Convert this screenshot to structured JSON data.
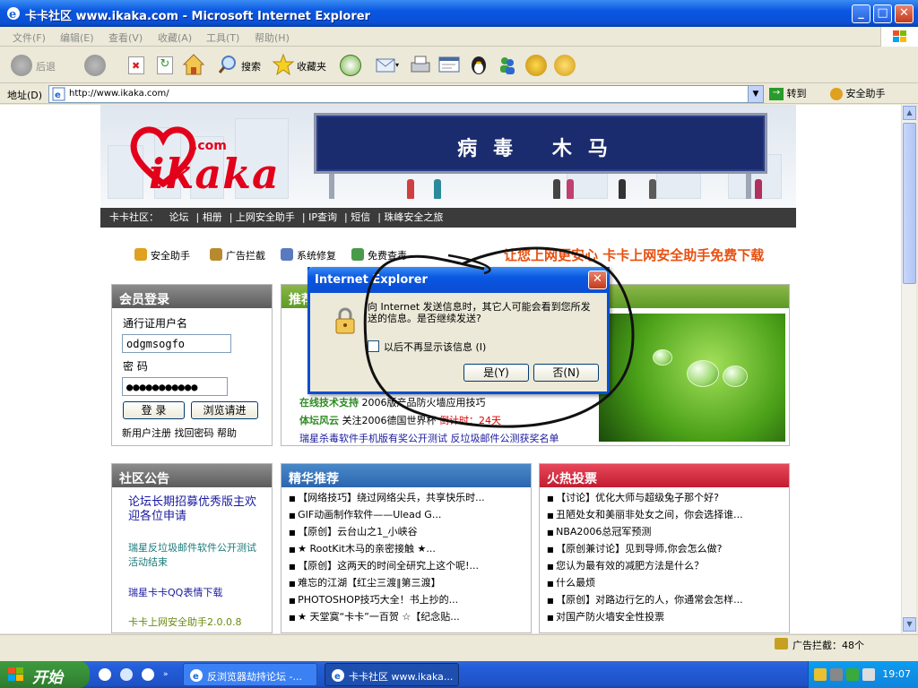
{
  "window": {
    "title": "卡卡社区 www.ikaka.com - Microsoft Internet Explorer"
  },
  "menu": [
    "文件(F)",
    "编辑(E)",
    "查看(V)",
    "收藏(A)",
    "工具(T)",
    "帮助(H)"
  ],
  "toolbar": {
    "back": "后退",
    "search": "搜索",
    "favorites": "收藏夹"
  },
  "address": {
    "label": "地址(D)",
    "url": "http://www.ikaka.com/",
    "go": "转到",
    "safety": "安全助手"
  },
  "banner": {
    "logo": "ikaka",
    "logo_com": ".com",
    "board": "病毒 木马"
  },
  "nav": {
    "label": "卡卡社区：",
    "items": [
      "论坛",
      "相册",
      "上网安全助手",
      "IP查询",
      "短信",
      "珠峰安全之旅"
    ]
  },
  "quick": {
    "items": [
      "安全助手",
      "广告拦截",
      "系统修复",
      "免费查毒"
    ],
    "slogan": "让您上网更安心 卡卡上网安全助手免费下载"
  },
  "login": {
    "title": "会员登录",
    "user_label": "通行证用户名",
    "username": "odgmsogfo",
    "pwd_label": "密  码",
    "password": "●●●●●●●●●●●",
    "login_btn": "登 录",
    "browse_btn": "浏览请进",
    "links": [
      "新用户注册",
      "找回密码",
      "帮助"
    ]
  },
  "recommend": {
    "title": "推荐",
    "items": [
      {
        "tag": "在线技术支持",
        "text": "2006版产品防火墙应用技巧"
      },
      {
        "tag": "体坛风云",
        "text": "关注2006德国世界杯",
        "hot": "倒计时：24天"
      }
    ],
    "bottom": "瑞星杀毒软件手机版有奖公开测试  反垃圾邮件公测获奖名单"
  },
  "notice": {
    "title": "社区公告",
    "items": [
      "论坛长期招募优秀版主欢迎各位申请",
      "瑞星反垃圾邮件软件公开测试活动结束",
      "瑞星卡卡QQ表情下载",
      "卡卡上网安全助手2.0.0.8"
    ]
  },
  "featured": {
    "title": "精华推荐",
    "items": [
      "【网络技巧】绕过网络尖兵，共享快乐时...",
      "GIF动画制作软件——Ulead G...",
      "【原创】云台山之1_小峡谷",
      "★ RootKit木马的亲密接触 ★...",
      "【原创】这两天的时间全研究上这个呢!...",
      "难忘的江湖【红尘三渡‖第三渡】",
      "PHOTOSHOP技巧大全！书上抄的...",
      "★  天堂寞“卡卡”一百贺  ☆【纪念贴..."
    ]
  },
  "hot": {
    "title": "火热投票",
    "items": [
      "【讨论】优化大师与超级兔子那个好?",
      "丑陋处女和美丽非处女之间，你会选择谁...",
      "NBA2006总冠军预测",
      "【原创兼讨论】见到导师,你会怎么做?",
      "您认为最有效的减肥方法是什么？",
      "什么最烦",
      "【原创】对路边行乞的人，你通常会怎样...",
      "对国产防火墙安全性投票"
    ]
  },
  "dialog": {
    "title": "Internet Explorer",
    "message": "向 Internet 发送信息时，其它人可能会看到您所发送的信息。是否继续发送?",
    "checkbox": "以后不再显示该信息 (I)",
    "yes": "是(Y)",
    "no": "否(N)"
  },
  "status": {
    "adblock": "广告拦截：48个"
  },
  "taskbar": {
    "start": "开始",
    "tasks": [
      "反浏览器劫持论坛 -...",
      "卡卡社区 www.ikaka..."
    ],
    "clock": "19:07"
  }
}
